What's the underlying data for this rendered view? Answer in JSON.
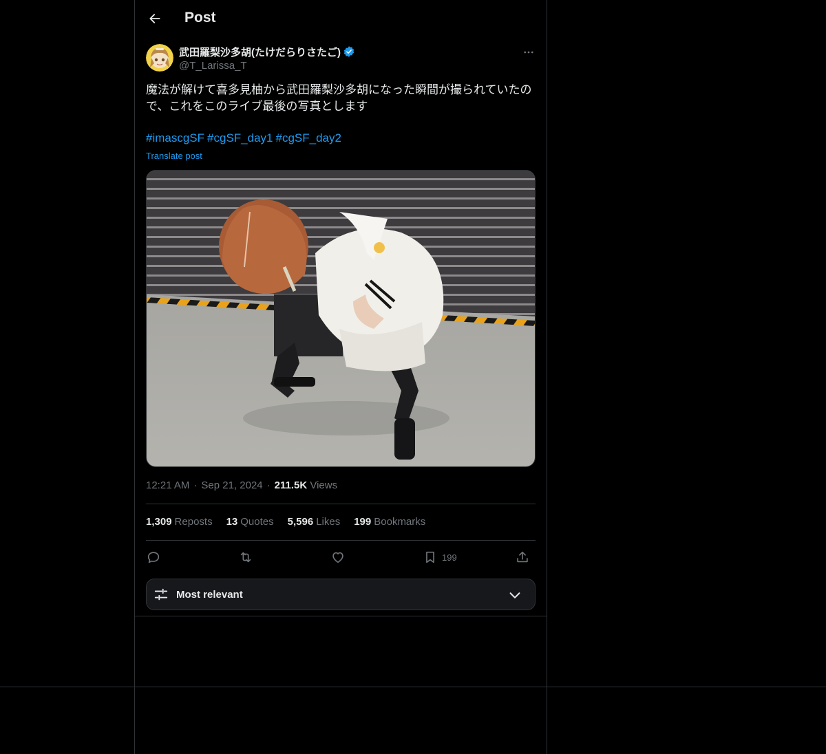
{
  "header": {
    "title": "Post"
  },
  "author": {
    "display_name": "武田羅梨沙多胡(たけだらりさたご)",
    "handle": "@T_Larissa_T"
  },
  "post": {
    "text": "魔法が解けて喜多見柚から武田羅梨沙多胡になった瞬間が撮られていたので、これをこのライブ最後の写真とします",
    "hashtags": [
      "#imascgSF",
      "#cgSF_day1",
      "#cgSF_day2"
    ],
    "translate_label": "Translate post"
  },
  "meta": {
    "time": "12:21 AM",
    "separator": "·",
    "date": "Sep 21, 2024",
    "views_count": "211.5K",
    "views_label": "Views"
  },
  "stats": [
    {
      "count": "1,309",
      "label": "Reposts"
    },
    {
      "count": "13",
      "label": "Quotes"
    },
    {
      "count": "5,596",
      "label": "Likes"
    },
    {
      "count": "199",
      "label": "Bookmarks"
    }
  ],
  "actions": {
    "reply_icon": "reply-icon",
    "repost_icon": "repost-icon",
    "like_icon": "like-icon",
    "bookmark_icon": "bookmark-icon",
    "bookmark_count": "199",
    "share_icon": "share-icon"
  },
  "sort": {
    "label": "Most relevant"
  },
  "colors": {
    "accent": "#1d9bf0",
    "background": "#000000",
    "border": "#2f3336",
    "muted": "#71767b"
  }
}
